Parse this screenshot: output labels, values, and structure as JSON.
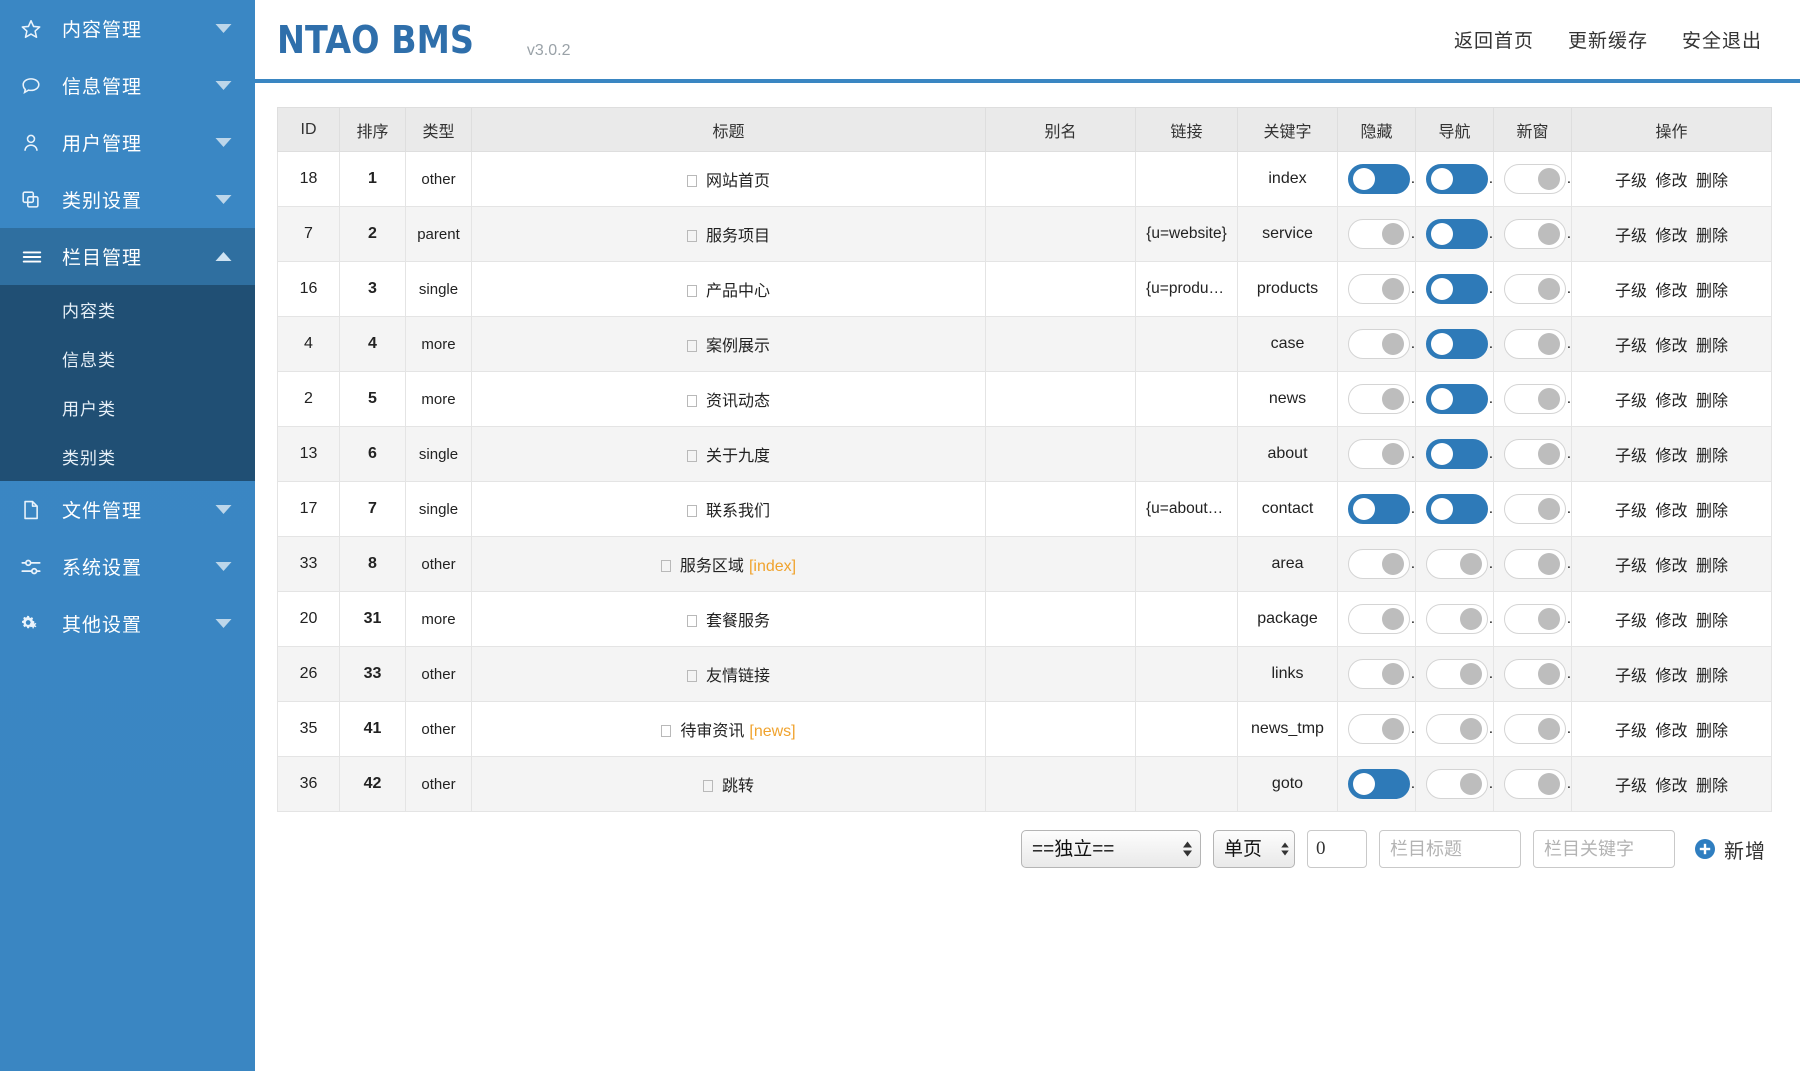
{
  "sidebar": {
    "items": [
      {
        "label": "内容管理",
        "icon": "star-icon",
        "expanded": false
      },
      {
        "label": "信息管理",
        "icon": "comment-icon",
        "expanded": false
      },
      {
        "label": "用户管理",
        "icon": "user-icon",
        "expanded": false
      },
      {
        "label": "类别设置",
        "icon": "copy-icon",
        "expanded": false
      },
      {
        "label": "栏目管理",
        "icon": "bars-icon",
        "expanded": true
      },
      {
        "label": "文件管理",
        "icon": "file-icon",
        "expanded": false
      },
      {
        "label": "系统设置",
        "icon": "sliders-icon",
        "expanded": false
      },
      {
        "label": "其他设置",
        "icon": "gears-icon",
        "expanded": false
      }
    ],
    "submenu": [
      {
        "label": "内容类"
      },
      {
        "label": "信息类"
      },
      {
        "label": "用户类"
      },
      {
        "label": "类别类"
      }
    ]
  },
  "header": {
    "brand": "NTAO BMS",
    "version": "v3.0.2",
    "links": [
      {
        "label": "返回首页"
      },
      {
        "label": "更新缓存"
      },
      {
        "label": "安全退出"
      }
    ]
  },
  "table": {
    "columns": [
      "ID",
      "排序",
      "类型",
      "标题",
      "别名",
      "链接",
      "关键字",
      "隐藏",
      "导航",
      "新窗",
      "操作"
    ],
    "ops_labels": {
      "child": "子级",
      "edit": "修改",
      "delete": "删除"
    },
    "rows": [
      {
        "id": "18",
        "order": "1",
        "type": "other",
        "title": "网站首页",
        "tag": "",
        "alias": "",
        "link": "",
        "keyword": "index",
        "hidden": true,
        "nav": true,
        "newwin": false
      },
      {
        "id": "7",
        "order": "2",
        "type": "parent",
        "title": "服务项目",
        "tag": "",
        "alias": "",
        "link": "{u=website}",
        "keyword": "service",
        "hidden": false,
        "nav": true,
        "newwin": false
      },
      {
        "id": "16",
        "order": "3",
        "type": "single",
        "title": "产品中心",
        "tag": "",
        "alias": "",
        "link": "{u=products…",
        "keyword": "products",
        "hidden": false,
        "nav": true,
        "newwin": false
      },
      {
        "id": "4",
        "order": "4",
        "type": "more",
        "title": "案例展示",
        "tag": "",
        "alias": "",
        "link": "",
        "keyword": "case",
        "hidden": false,
        "nav": true,
        "newwin": false
      },
      {
        "id": "2",
        "order": "5",
        "type": "more",
        "title": "资讯动态",
        "tag": "",
        "alias": "",
        "link": "",
        "keyword": "news",
        "hidden": false,
        "nav": true,
        "newwin": false
      },
      {
        "id": "13",
        "order": "6",
        "type": "single",
        "title": "关于九度",
        "tag": "",
        "alias": "",
        "link": "",
        "keyword": "about",
        "hidden": false,
        "nav": true,
        "newwin": false
      },
      {
        "id": "17",
        "order": "7",
        "type": "single",
        "title": "联系我们",
        "tag": "",
        "alias": "",
        "link": "{u=about&k…",
        "keyword": "contact",
        "hidden": true,
        "nav": true,
        "newwin": false
      },
      {
        "id": "33",
        "order": "8",
        "type": "other",
        "title": "服务区域",
        "tag": "[index]",
        "alias": "",
        "link": "",
        "keyword": "area",
        "hidden": false,
        "nav": false,
        "newwin": false
      },
      {
        "id": "20",
        "order": "31",
        "type": "more",
        "title": "套餐服务",
        "tag": "",
        "alias": "",
        "link": "",
        "keyword": "package",
        "hidden": false,
        "nav": false,
        "newwin": false
      },
      {
        "id": "26",
        "order": "33",
        "type": "other",
        "title": "友情链接",
        "tag": "",
        "alias": "",
        "link": "",
        "keyword": "links",
        "hidden": false,
        "nav": false,
        "newwin": false
      },
      {
        "id": "35",
        "order": "41",
        "type": "other",
        "title": "待审资讯",
        "tag": "[news]",
        "alias": "",
        "link": "",
        "keyword": "news_tmp",
        "hidden": false,
        "nav": false,
        "newwin": false
      },
      {
        "id": "36",
        "order": "42",
        "type": "other",
        "title": "跳转",
        "tag": "",
        "alias": "",
        "link": "",
        "keyword": "goto",
        "hidden": true,
        "nav": false,
        "newwin": false
      }
    ]
  },
  "footer_form": {
    "isolation_select": "==独立==",
    "page_select": "单页",
    "order_value": "0",
    "title_placeholder": "栏目标题",
    "keyword_placeholder": "栏目关键字",
    "add_label": "新增"
  },
  "colors": {
    "sidebar": "#3a86c2",
    "sidebar_active": "#2f6fa0",
    "submenu": "#204f74",
    "brand": "#2f6fab",
    "accent": "#2e7ab8",
    "type_other": "#f0a32e",
    "type_parent": "#ee1c1c",
    "type_single": "#15a915",
    "type_more": "#3b1ce0"
  }
}
